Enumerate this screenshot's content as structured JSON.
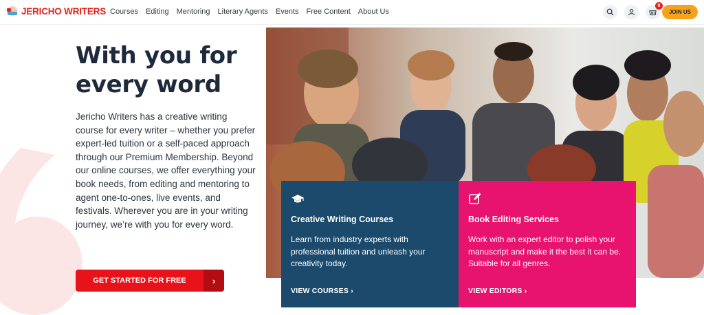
{
  "brand": {
    "name": "JERICHO WRITERS",
    "color": "#e2231a"
  },
  "nav": {
    "items": [
      "Courses",
      "Editing",
      "Mentoring",
      "Literary Agents",
      "Events",
      "Free Content",
      "About Us"
    ]
  },
  "header_actions": {
    "search_icon": "search-icon",
    "account_icon": "user-icon",
    "basket_icon": "basket-icon",
    "basket_count": "0",
    "join_label": "JOIN US",
    "join_color": "#f7a21b"
  },
  "hero": {
    "title": "With you for every word",
    "body": "Jericho Writers has a creative writing course for every writer – whether you prefer expert-led tuition or a self-paced approach through our Premium Membership. Beyond our online courses, we offer everything your book needs, from editing and mentoring to agent one-to-ones, live events, and festivals. Wherever you are in your writing journey, we’re with you for every word.",
    "cta_label": "GET STARTED FOR FREE",
    "cta_arrow": "›",
    "cta_color": "#e8121a"
  },
  "cards": [
    {
      "icon": "graduation-cap-icon",
      "title": "Creative Writing Courses",
      "text": "Learn from industry experts with professional tuition and unleash your creativity today.",
      "link": "VIEW COURSES",
      "link_arrow": "›",
      "color": "#1b4a6d"
    },
    {
      "icon": "edit-icon",
      "title": "Book Editing Services",
      "text": "Work with an expert editor to polish your manuscript and make it the best it can be. Suitable for all genres.",
      "link": "VIEW EDITORS",
      "link_arrow": "›",
      "color": "#e8126f"
    }
  ]
}
